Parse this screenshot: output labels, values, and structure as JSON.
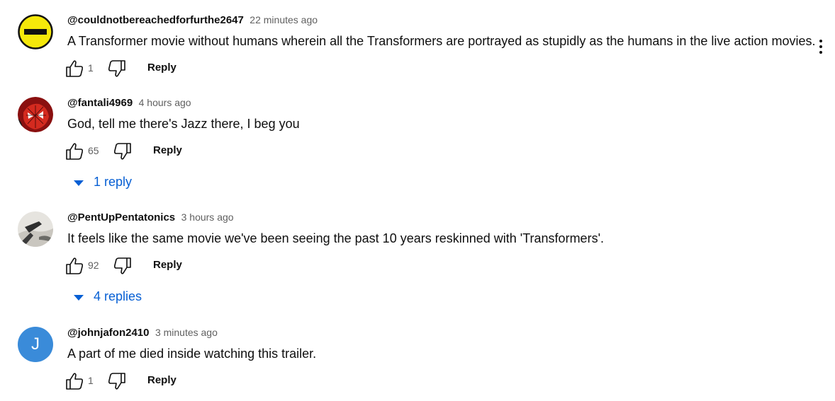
{
  "comments": [
    {
      "author": "@couldnotbereachedforfurthe2647",
      "time": "22 minutes ago",
      "text": "A Transformer movie without humans wherein all the Transformers are portrayed as stupidly as the humans in the live action movies.",
      "likes": "1",
      "reply_label": "Reply",
      "avatar_icon": "yellow-minus-face-icon"
    },
    {
      "author": "@fantali4969",
      "time": "4 hours ago",
      "text": "God, tell me there's Jazz there, I beg you",
      "likes": "65",
      "reply_label": "Reply",
      "replies_label": "1 reply",
      "avatar_icon": "spider-man-face-icon"
    },
    {
      "author": "@PentUpPentatonics",
      "time": "3 hours ago",
      "text": "It feels like the same movie we've been seeing the past 10 years reskinned with 'Transformers'.",
      "likes": "92",
      "reply_label": "Reply",
      "replies_label": "4 replies",
      "avatar_icon": "landscape-photo-icon"
    },
    {
      "author": "@johnjafon2410",
      "time": "3 minutes ago",
      "text": "A part of me died inside watching this trailer.",
      "likes": "1",
      "reply_label": "Reply",
      "avatar_letter": "J",
      "avatar_color": "#3a8bd9"
    }
  ],
  "colors": {
    "link_blue": "#065fd4",
    "secondary_text": "#606060"
  }
}
